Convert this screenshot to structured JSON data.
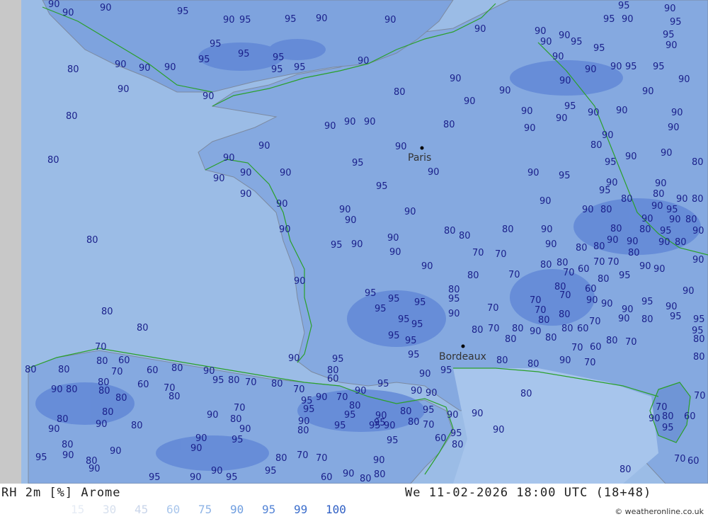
{
  "map": {
    "cities": [
      {
        "name": "Paris"
      },
      {
        "name": "Bordeaux"
      }
    ],
    "contour_labels": [
      "90",
      "95",
      "80",
      "70",
      "60"
    ]
  },
  "footer": {
    "title": "RH 2m [%] Arome",
    "datetime": "We 11-02-2026 18:00 UTC (18+48)",
    "legend": [
      {
        "label": "15",
        "color": "#e6ecf5"
      },
      {
        "label": "30",
        "color": "#d7e0ee"
      },
      {
        "label": "45",
        "color": "#c9d5ea"
      },
      {
        "label": "60",
        "color": "#a9c6ec"
      },
      {
        "label": "75",
        "color": "#8fb4e6"
      },
      {
        "label": "90",
        "color": "#6f9ee0"
      },
      {
        "label": "95",
        "color": "#5585d6"
      },
      {
        "label": "99",
        "color": "#3d6fcc"
      },
      {
        "label": "100",
        "color": "#2f5fc4"
      }
    ],
    "credit": "© weatheronline.co.uk"
  }
}
